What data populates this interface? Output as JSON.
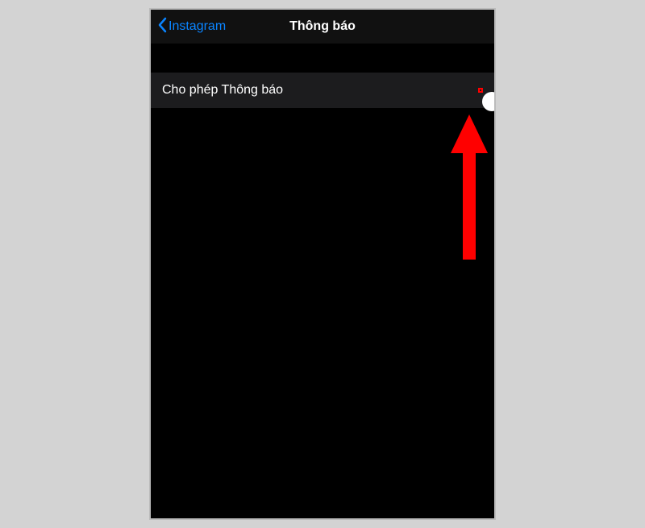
{
  "nav": {
    "back_label": "Instagram",
    "title": "Thông báo"
  },
  "settings": {
    "allow_notifications_label": "Cho phép Thông báo",
    "allow_notifications_on": false
  },
  "colors": {
    "accent": "#0a84ff",
    "highlight": "#ff0000"
  }
}
